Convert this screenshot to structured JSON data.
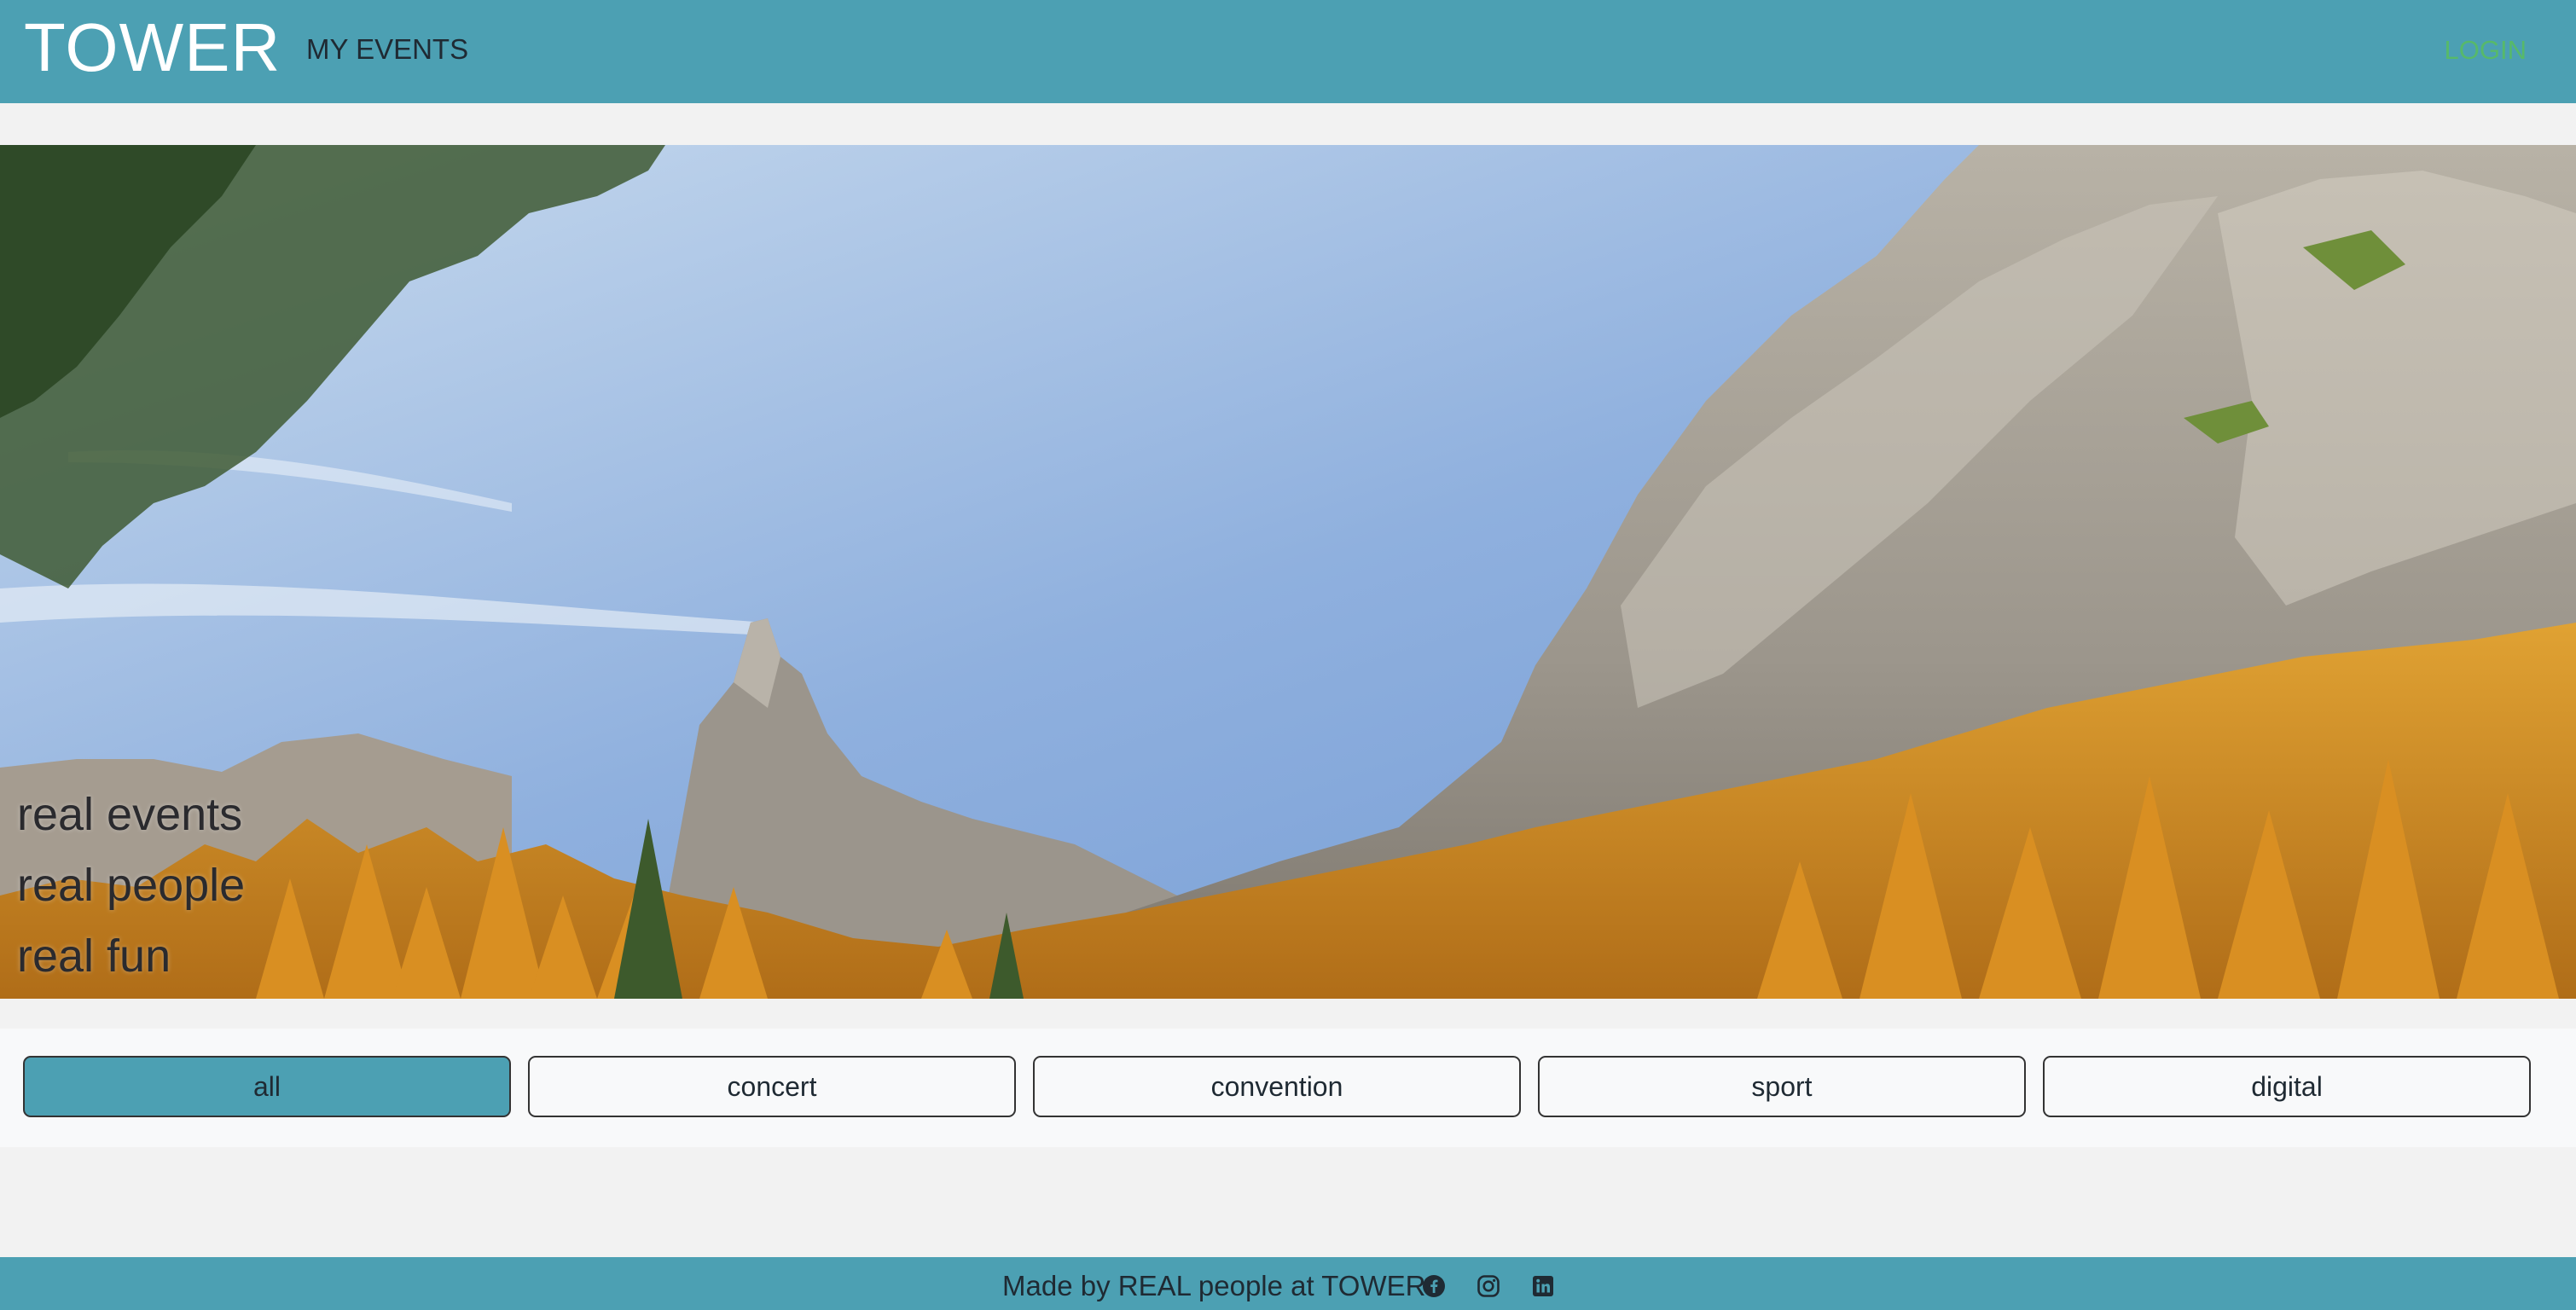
{
  "navbar": {
    "brand": "TOWER",
    "links": [
      "MY EVENTS"
    ],
    "login_label": "LOGIN"
  },
  "hero": {
    "taglines": [
      "real events",
      "real people",
      "real fun"
    ]
  },
  "filters": {
    "items": [
      "all",
      "concert",
      "convention",
      "sport",
      "digital"
    ],
    "active": "all"
  },
  "footer": {
    "text": "Made by REAL people at TOWER",
    "icons": [
      "facebook-icon",
      "instagram-icon",
      "linkedin-icon"
    ]
  },
  "colors": {
    "primary": "#4ca0b3",
    "login": "#57b96a",
    "page_bg": "#f2f2f2"
  }
}
